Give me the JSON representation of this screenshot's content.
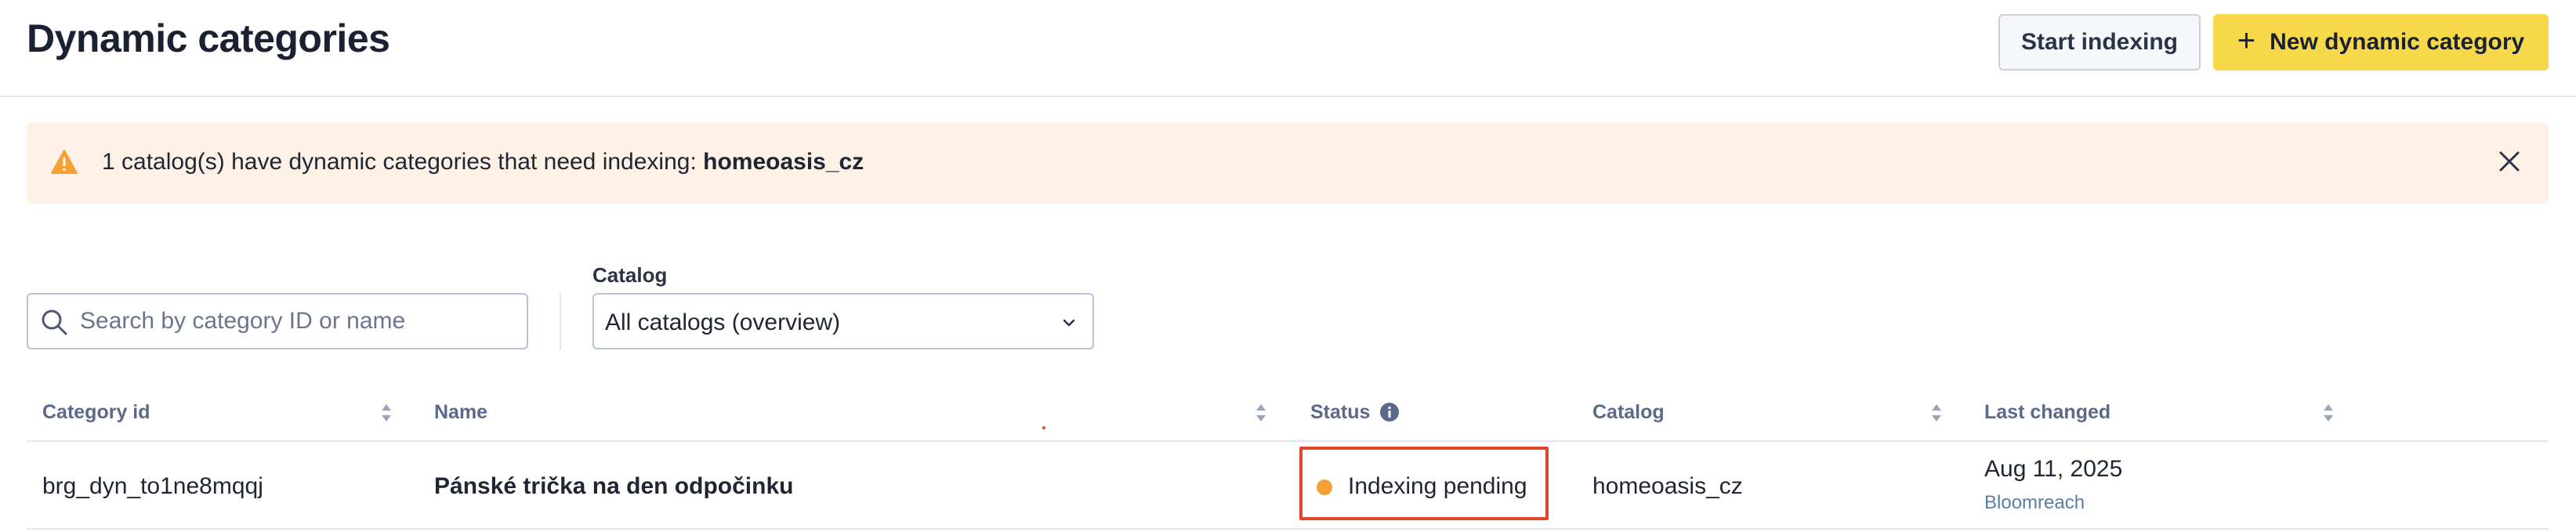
{
  "header": {
    "title": "Dynamic categories",
    "start_indexing_label": "Start indexing",
    "new_category_plus": "+",
    "new_category_label": "New dynamic category"
  },
  "alert": {
    "message": "1 catalog(s) have dynamic categories that need indexing:",
    "catalog": "homeoasis_cz",
    "icon": "warning-icon",
    "close_icon": "close-icon"
  },
  "filters": {
    "search_placeholder": "Search by category ID or name",
    "search_value": "",
    "catalog_label": "Catalog",
    "catalog_selected": "All catalogs (overview)"
  },
  "table": {
    "columns": {
      "category_id": "Category id",
      "name": "Name",
      "status": "Status",
      "catalog": "Catalog",
      "last_changed": "Last changed"
    },
    "rows": [
      {
        "category_id": "brg_dyn_to1ne8mqqj",
        "name": "Pánské trička na den odpočinku",
        "status": "Indexing pending",
        "catalog": "homeoasis_cz",
        "last_changed_date": "Aug 11, 2025",
        "last_changed_by": "Bloomreach"
      }
    ]
  },
  "colors": {
    "primary_button": "#f7d84a",
    "alert_bg": "#fdf1e6",
    "warning": "#f5a033",
    "highlight_border": "#e5452a"
  }
}
